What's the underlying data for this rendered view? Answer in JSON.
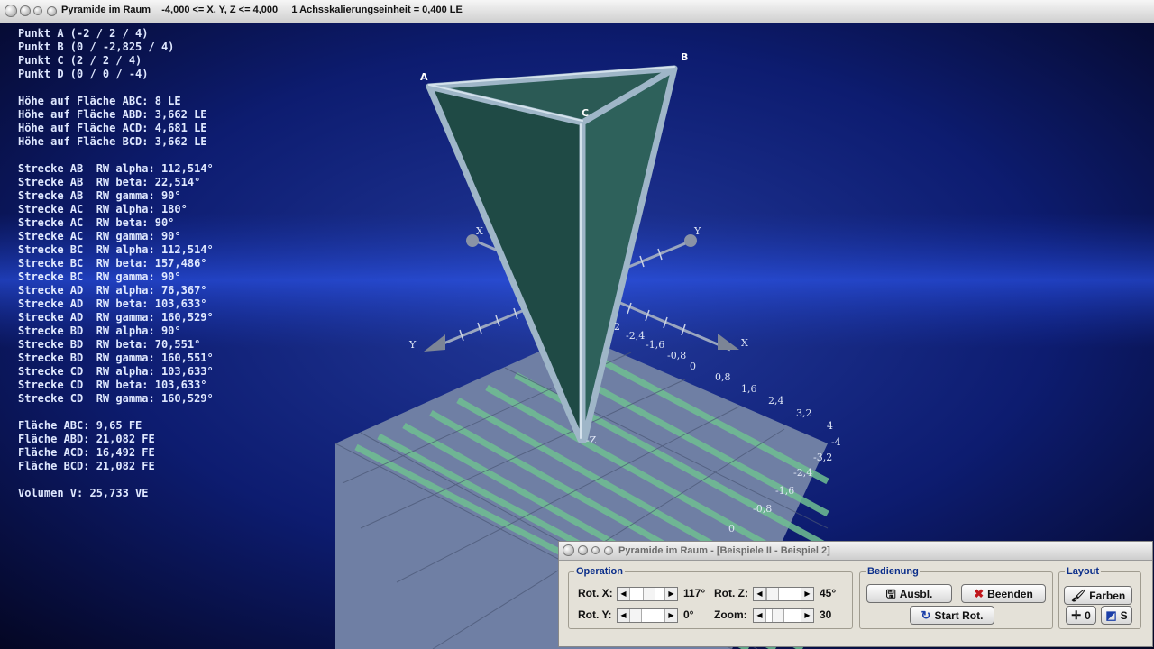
{
  "window": {
    "title": "Pyramide im Raum    -4,000 <= X, Y, Z <= 4,000     1 Achsskalierungseinheit = 0,400 LE"
  },
  "info": {
    "points": [
      "Punkt A (-2 / 2 / 4)",
      "Punkt B (0 / -2,825 / 4)",
      "Punkt C (2 / 2 / 4)",
      "Punkt D (0 / 0 / -4)"
    ],
    "heights": [
      "Höhe auf Fläche ABC: 8 LE",
      "Höhe auf Fläche ABD: 3,662 LE",
      "Höhe auf Fläche ACD: 4,681 LE",
      "Höhe auf Fläche BCD: 3,662 LE"
    ],
    "angles": [
      "Strecke AB  RW alpha: 112,514°",
      "Strecke AB  RW beta: 22,514°",
      "Strecke AB  RW gamma: 90°",
      "Strecke AC  RW alpha: 180°",
      "Strecke AC  RW beta: 90°",
      "Strecke AC  RW gamma: 90°",
      "Strecke BC  RW alpha: 112,514°",
      "Strecke BC  RW beta: 157,486°",
      "Strecke BC  RW gamma: 90°",
      "Strecke AD  RW alpha: 76,367°",
      "Strecke AD  RW beta: 103,633°",
      "Strecke AD  RW gamma: 160,529°",
      "Strecke BD  RW alpha: 90°",
      "Strecke BD  RW beta: 70,551°",
      "Strecke BD  RW gamma: 160,551°",
      "Strecke CD  RW alpha: 103,633°",
      "Strecke CD  RW beta: 103,633°",
      "Strecke CD  RW gamma: 160,529°"
    ],
    "areas": [
      "Fläche ABC: 9,65 FE",
      "Fläche ABD: 21,082 FE",
      "Fläche ACD: 16,492 FE",
      "Fläche BCD: 21,082 FE"
    ],
    "volume": "Volumen V: 25,733 VE"
  },
  "scene": {
    "vertex_labels": {
      "a": "A",
      "b": "B",
      "c": "C"
    },
    "axis_labels": {
      "x_pos": "X",
      "x_neg": "X",
      "y_pos": "Y",
      "y_neg": "Y",
      "z_neg": "-Z"
    },
    "x_ticks": [
      "-2,4",
      "-1,6",
      "-0,8",
      "0",
      "0,8",
      "1,6",
      "2,4",
      "3,2",
      "4"
    ],
    "y_ticks": [
      "-4",
      "-3,2",
      "-2,4",
      "-1,6",
      "-0,8",
      "0"
    ],
    "tick_2": "2"
  },
  "panel": {
    "title": "Pyramide im Raum - [Beispiele II - Beispiel 2]",
    "operation": {
      "legend": "Operation",
      "rot_x_label": "Rot. X:",
      "rot_x_value": "117°",
      "rot_y_label": "Rot. Y:",
      "rot_y_value": "0°",
      "rot_z_label": "Rot. Z:",
      "rot_z_value": "45°",
      "zoom_label": "Zoom:",
      "zoom_value": "30"
    },
    "bedienung": {
      "legend": "Bedienung",
      "ausbl": "Ausbl.",
      "beenden": "Beenden",
      "start_rot": "Start Rot."
    },
    "layout": {
      "legend": "Layout",
      "farben": "Farben",
      "zero": "0",
      "s": "S"
    }
  }
}
